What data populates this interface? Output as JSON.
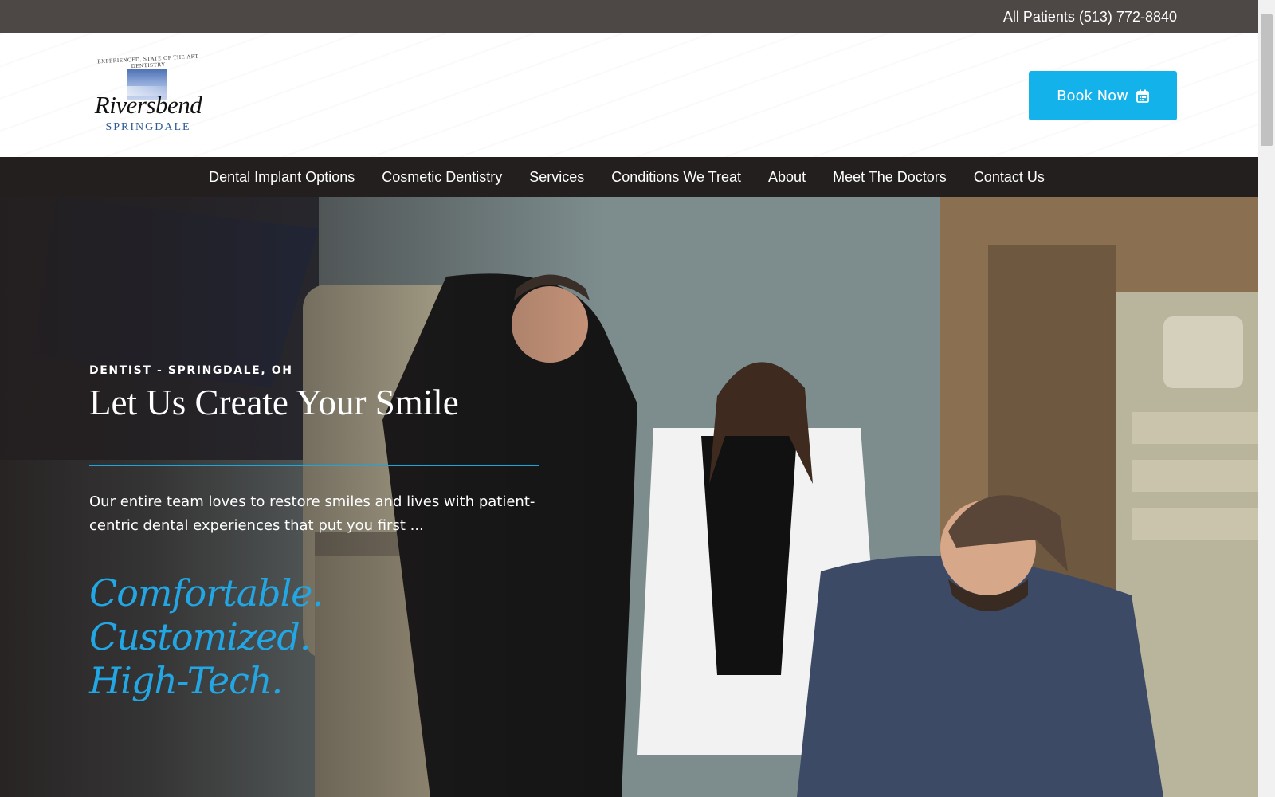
{
  "topbar": {
    "phone": "All Patients (513) 772-8840"
  },
  "logo": {
    "tagline": "EXPERIENCED, STATE OF THE ART DENTISTRY",
    "brand": "Riversbend",
    "sub": "SPRINGDALE"
  },
  "header": {
    "book_label": "Book Now"
  },
  "nav": {
    "items": [
      "Dental Implant Options",
      "Cosmetic Dentistry",
      "Services",
      "Conditions We Treat",
      "About",
      "Meet The Doctors",
      "Contact Us"
    ]
  },
  "hero": {
    "eyebrow": "DENTIST - SPRINGDALE, OH",
    "headline": "Let Us Create Your Smile",
    "body": "Our entire team loves to restore smiles and lives with patient-centric dental experiences that put you first ...",
    "script_line1": "Comfortable. Customized.",
    "script_line2": "High-Tech."
  },
  "colors": {
    "topbar": "#4d4846",
    "nav": "#231f1e",
    "accent": "#14b2ea",
    "script": "#22a7e4"
  },
  "icons": {
    "book": "calendar-icon"
  }
}
